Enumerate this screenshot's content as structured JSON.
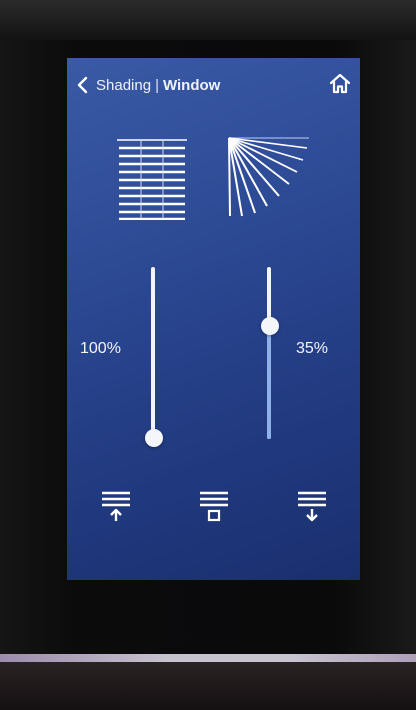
{
  "header": {
    "parent": "Shading",
    "separator": "|",
    "current": "Window"
  },
  "icons": {
    "back": "chevron-left",
    "home": "house",
    "blinds": "venetian-blinds",
    "tilt": "slat-tilt",
    "up": "blind-up",
    "stop": "blind-stop",
    "down": "blind-down"
  },
  "position_slider": {
    "value_label": "100%",
    "value": 100
  },
  "tilt_slider": {
    "value_label": "35%",
    "value": 35
  },
  "colors": {
    "screen": "#2d4a95",
    "accent": "#8fb0e8",
    "icon": "#ffffff"
  }
}
